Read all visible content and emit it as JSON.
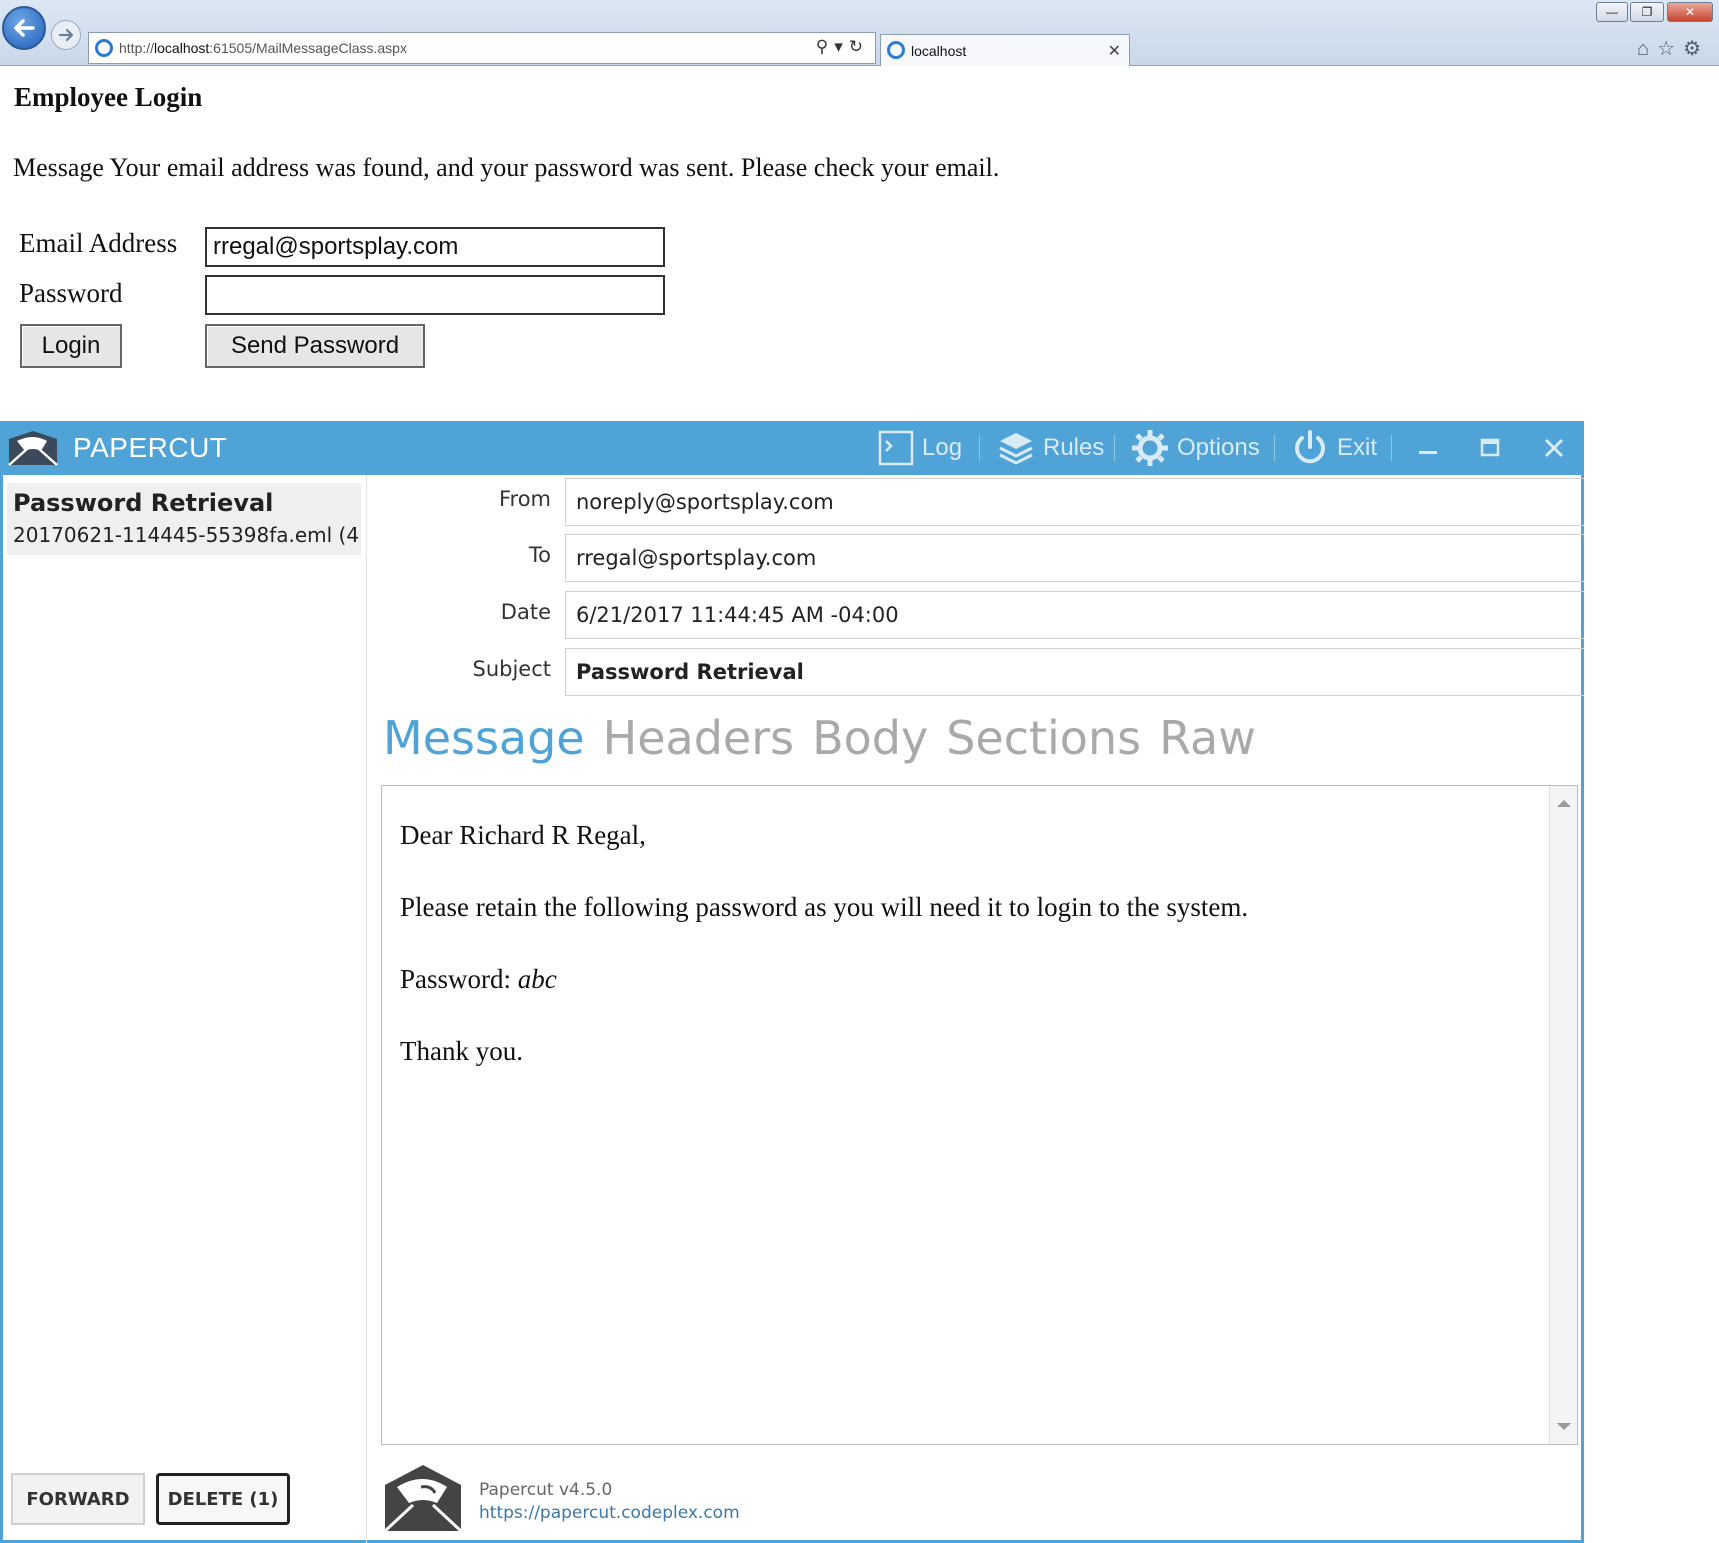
{
  "browser": {
    "url_prefix": "http://",
    "url_host": "localhost",
    "url_rest": ":61505/MailMessageClass.aspx",
    "tab_title": "localhost"
  },
  "page": {
    "heading": "Employee Login",
    "message": "Message Your email address was found, and your password was sent. Please check your email.",
    "email_label": "Email Address",
    "email_value": "rregal@sportsplay.com",
    "password_label": "Password",
    "password_value": "",
    "login_button": "Login",
    "send_password_button": "Send Password"
  },
  "papercut": {
    "app_title": "PAPERCUT",
    "toolbar": {
      "log": "Log",
      "rules": "Rules",
      "options": "Options",
      "exit": "Exit"
    },
    "message_list": [
      {
        "title": "Password Retrieval",
        "file": "20170621-114445-55398fa.eml (4.."
      }
    ],
    "headers": {
      "from_label": "From",
      "from": "noreply@sportsplay.com",
      "to_label": "To",
      "to": "rregal@sportsplay.com",
      "date_label": "Date",
      "date": "6/21/2017 11:44:45 AM -04:00",
      "subject_label": "Subject",
      "subject": "Password Retrieval"
    },
    "tabs": [
      "Message",
      "Headers",
      "Body",
      "Sections",
      "Raw"
    ],
    "active_tab": "Message",
    "body": {
      "greeting": "Dear Richard R Regal,",
      "line1": "Please retain the following password as you will need it to login to the system.",
      "password_prefix": "Password: ",
      "password": "abc",
      "closing": "Thank you."
    },
    "forward_button": "FORWARD",
    "delete_button": "DELETE (1)",
    "version": "Papercut v4.5.0",
    "site": "https://papercut.codeplex.com",
    "accent_color": "#4fa3d6"
  }
}
